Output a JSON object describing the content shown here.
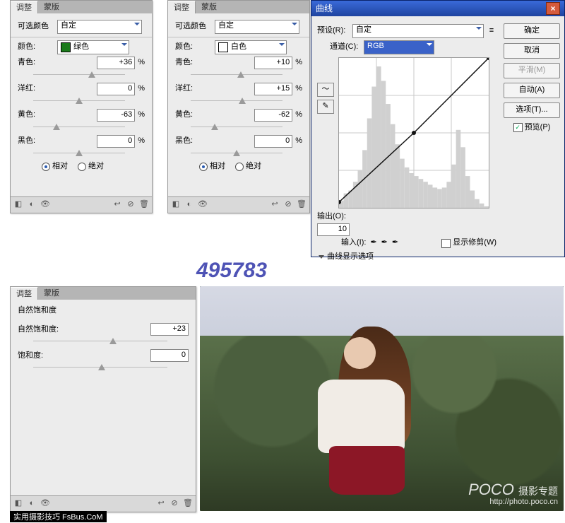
{
  "tabs": {
    "adjust": "调整",
    "mask": "蒙版"
  },
  "selColor": {
    "title": "可选颜色",
    "presetLabel": "自定",
    "colorLabel": "颜色:",
    "sliders": [
      "青色:",
      "洋红:",
      "黄色:",
      "黑色:"
    ],
    "pct": "%",
    "rel": "相对",
    "abs": "绝对"
  },
  "panel1": {
    "colorName": "绿色",
    "swatch": "#1a7a1a",
    "vals": [
      "+36",
      "0",
      "-63",
      "0"
    ]
  },
  "panel2": {
    "colorName": "白色",
    "swatch": "#ffffff",
    "vals": [
      "+10",
      "+15",
      "-62",
      "0"
    ]
  },
  "vib": {
    "title": "自然饱和度",
    "nat": "自然饱和度:",
    "sat": "饱和度:",
    "natVal": "+23",
    "satVal": "0"
  },
  "curves": {
    "title": "曲线",
    "presetLbl": "预设(R):",
    "presetVal": "自定",
    "channelLbl": "通道(C):",
    "channelVal": "RGB",
    "outputLbl": "输出(O):",
    "outputVal": "10",
    "inputLbl": "输入(I):",
    "showClip": "显示修剪(W)",
    "section": "曲线显示选项",
    "btns": {
      "ok": "确定",
      "cancel": "取消",
      "smooth": "平滑(M)",
      "auto": "自动(A)",
      "opts": "选项(T)..."
    },
    "preview": "预览(P)"
  },
  "bignum": "495783",
  "watermark": {
    "brand": "POCO",
    "sub1": "摄影专题",
    "sub2": "http://photo.poco.cn"
  },
  "wmleft": "实用摄影技巧 FsBus.CoM",
  "chart_data": {
    "type": "line",
    "title": "曲线 (Curves) — RGB",
    "xlabel": "输入",
    "ylabel": "输出",
    "xlim": [
      0,
      255
    ],
    "ylim": [
      0,
      255
    ],
    "series": [
      {
        "name": "RGB",
        "points": [
          [
            0,
            10
          ],
          [
            128,
            128
          ],
          [
            255,
            255
          ]
        ]
      }
    ],
    "histogram": [
      5,
      10,
      12,
      18,
      26,
      40,
      62,
      84,
      98,
      88,
      72,
      58,
      44,
      34,
      28,
      24,
      22,
      20,
      18,
      16,
      14,
      13,
      14,
      18,
      30,
      54,
      42,
      22,
      12,
      6,
      3,
      1
    ]
  }
}
